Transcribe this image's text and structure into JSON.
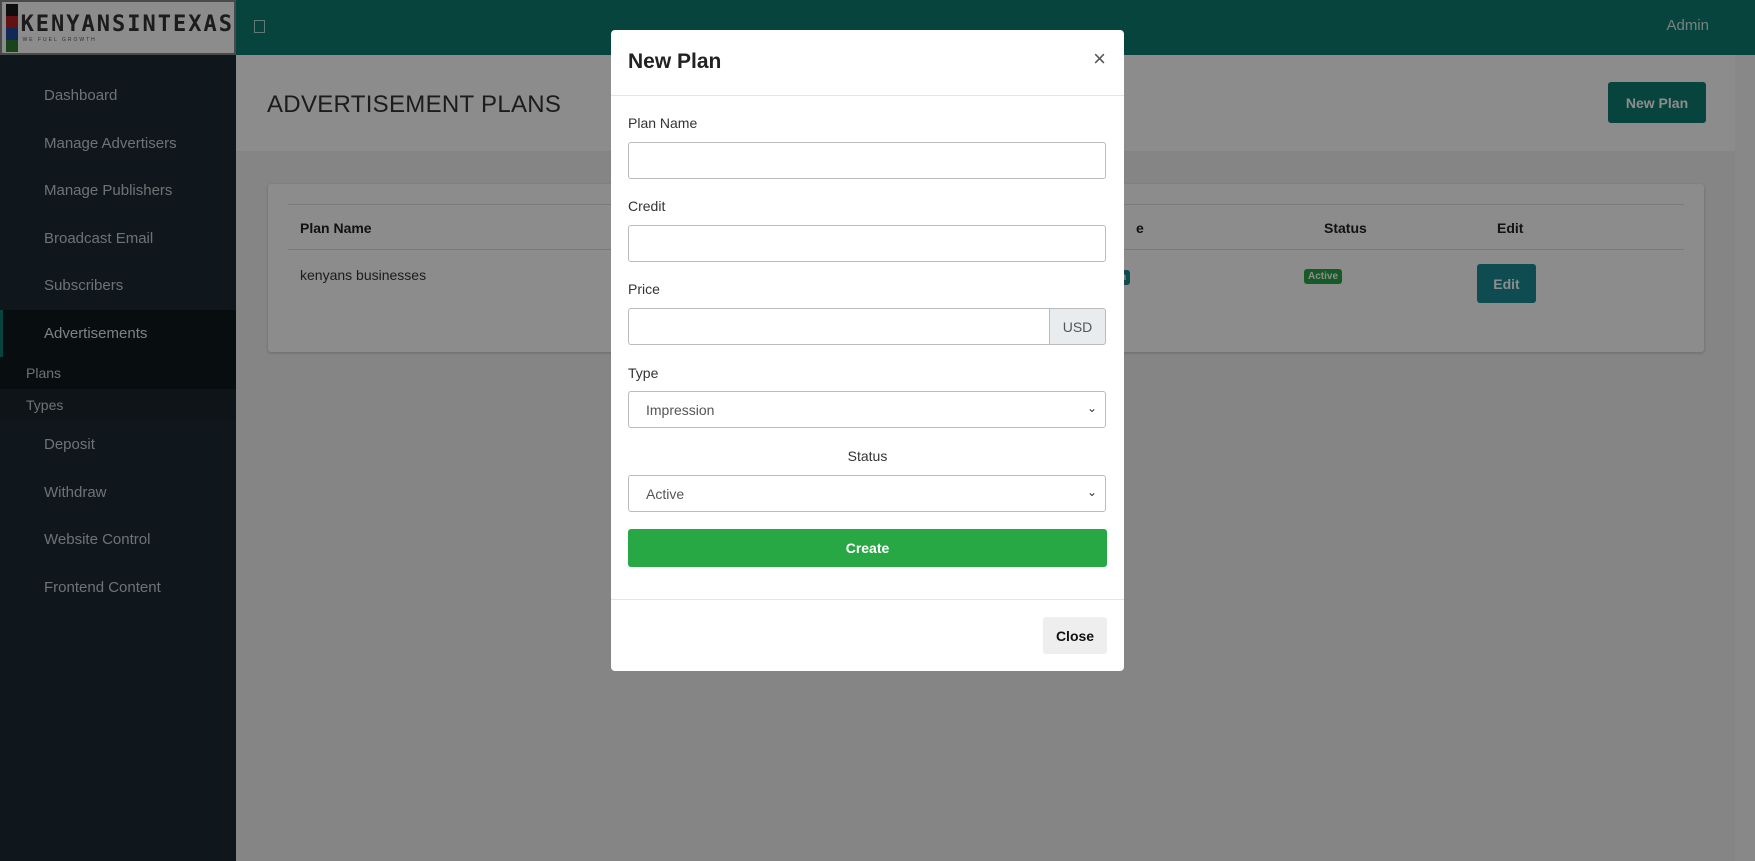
{
  "brand": {
    "logo_text": "KENYANSINTEXAS",
    "logo_tagline": "WE FUEL GROWTH"
  },
  "topbar": {
    "user": "Admin"
  },
  "sidebar": {
    "items": [
      {
        "label": "Dashboard"
      },
      {
        "label": "Manage Advertisers"
      },
      {
        "label": "Manage Publishers"
      },
      {
        "label": "Broadcast Email"
      },
      {
        "label": "Subscribers"
      },
      {
        "label": "Advertisements",
        "active": true
      }
    ],
    "subitems": [
      {
        "label": "Plans"
      },
      {
        "label": "Types"
      }
    ],
    "items_after": [
      {
        "label": "Deposit"
      },
      {
        "label": "Withdraw"
      },
      {
        "label": "Website Control"
      },
      {
        "label": "Frontend Content"
      }
    ]
  },
  "page": {
    "title": "ADVERTISEMENT PLANS",
    "new_plan_label": "New Plan"
  },
  "table": {
    "columns": [
      "Plan Name",
      "e",
      "Status",
      "Edit"
    ],
    "rows": [
      {
        "plan_name": "kenyans businesses",
        "type_badge": "on",
        "status": "Active",
        "edit_label": "Edit"
      }
    ]
  },
  "modal": {
    "title": "New Plan",
    "close_x": "×",
    "fields": {
      "plan_name": {
        "label": "Plan Name",
        "value": ""
      },
      "credit": {
        "label": "Credit",
        "value": ""
      },
      "price": {
        "label": "Price",
        "value": "",
        "addon": "USD"
      },
      "type": {
        "label": "Type",
        "value": "Impression"
      },
      "status": {
        "label": "Status",
        "value": "Active"
      }
    },
    "create_label": "Create",
    "close_label": "Close"
  },
  "colors": {
    "primary": "#0e7c6f",
    "sidebar": "#1c2a33",
    "success": "#28a745",
    "info": "#1c8a96"
  }
}
